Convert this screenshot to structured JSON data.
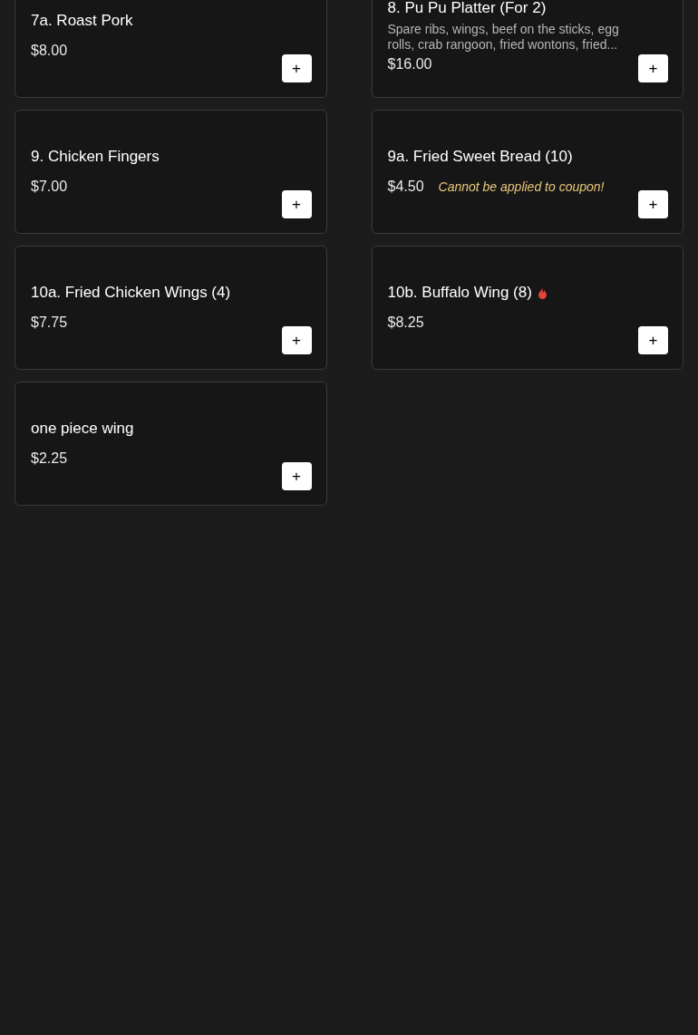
{
  "rows": [
    {
      "items": [
        {
          "name": "7a. Roast Pork",
          "price": "$8.00"
        },
        {
          "name": "8. Pu Pu Platter (For 2)",
          "description": "Spare ribs, wings, beef on the sticks, egg rolls, crab rangoon, fried wontons, fried...",
          "price": "$16.00"
        }
      ]
    },
    {
      "items": [
        {
          "name": "9. Chicken Fingers",
          "price": "$7.00"
        },
        {
          "name": "9a. Fried Sweet Bread (10)",
          "price": "$4.50",
          "note": "Cannot be applied to coupon!"
        }
      ]
    },
    {
      "items": [
        {
          "name": "10a. Fried Chicken Wings (4)",
          "price": "$7.75"
        },
        {
          "name": "10b. Buffalo Wing (8)",
          "price": "$8.25",
          "spicy": true
        }
      ]
    },
    {
      "items": [
        {
          "name": "one piece wing",
          "price": "$2.25"
        }
      ]
    }
  ],
  "add_button": "+"
}
